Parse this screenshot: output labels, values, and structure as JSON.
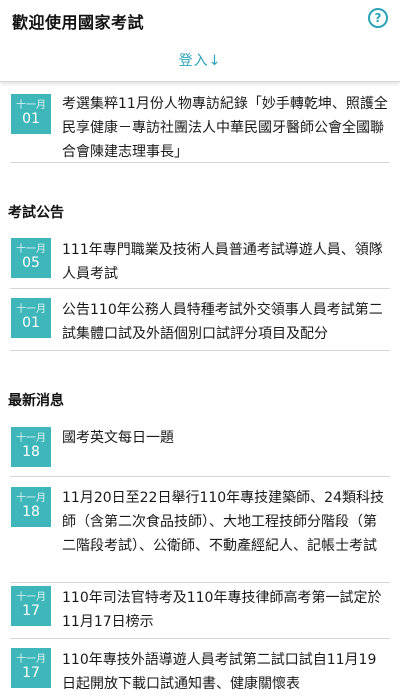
{
  "header": {
    "title": "歡迎使用國家考試",
    "help_icon": "?",
    "login_label": "登入↓"
  },
  "top_items": [
    {
      "month": "十一月",
      "day": "01",
      "text": "考選集粹11月份人物專訪紀錄「妙手轉乾坤、照護全民享健康－專訪社團法人中華民國牙醫師公會全國聯合會陳建志理事長」"
    }
  ],
  "exam_notices": {
    "title": "考試公告",
    "items": [
      {
        "month": "十一月",
        "day": "05",
        "text": "111年專門職業及技術人員普通考試導遊人員、領隊人員考試"
      },
      {
        "month": "十一月",
        "day": "01",
        "text": "公告110年公務人員特種考試外交領事人員考試第二試集體口試及外語個別口試評分項目及配分"
      }
    ]
  },
  "latest_news": {
    "title": "最新消息",
    "items": [
      {
        "month": "十一月",
        "day": "18",
        "text": "國考英文每日一題"
      },
      {
        "month": "十一月",
        "day": "18",
        "text": "11月20日至22日舉行110年專技建築師、24類科技師（含第二次食品技師）、大地工程技師分階段（第二階段考試）、公衛師、不動產經紀人、記帳士考試"
      },
      {
        "month": "十一月",
        "day": "17",
        "text": "110年司法官特考及110年專技律師高考第一試定於11月17日榜示"
      },
      {
        "month": "十一月",
        "day": "17",
        "text": "110年專技外語導遊人員考試第二試口試自11月19日起開放下載口試通知書、健康關懷表"
      }
    ]
  },
  "colors": {
    "accent": "#2aa3b9",
    "badge": "#3fb6b9"
  }
}
